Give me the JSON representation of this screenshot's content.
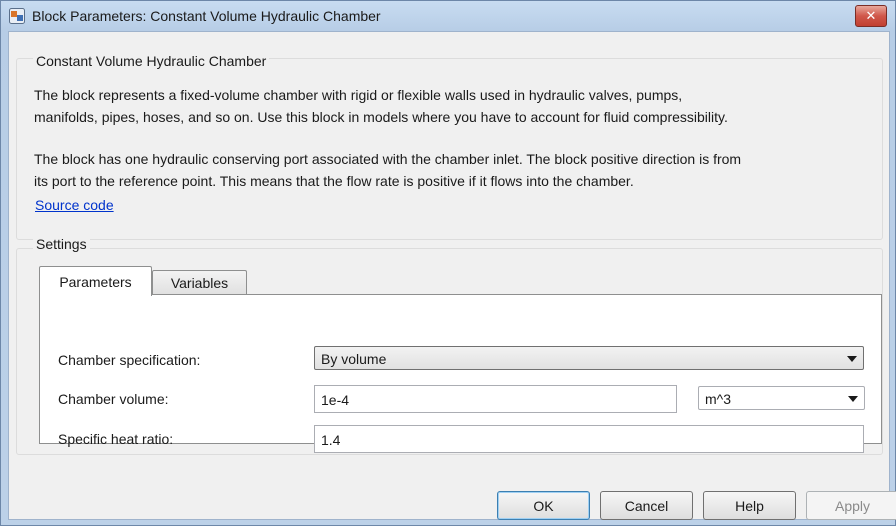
{
  "window": {
    "title": "Block Parameters: Constant Volume Hydraulic Chamber",
    "close_glyph": "✕"
  },
  "description": {
    "group_title": "Constant Volume Hydraulic Chamber",
    "paragraph1_line1": "The block represents a fixed-volume chamber with rigid or flexible walls used in hydraulic valves, pumps,",
    "paragraph1_line2": "manifolds, pipes, hoses, and so on. Use this block in models where you have to account for fluid compressibility.",
    "paragraph2_line1": "The block has one hydraulic conserving port associated with the chamber inlet. The block positive direction is from",
    "paragraph2_line2": "its port to the reference point. This means that the flow rate is positive if it flows into the chamber.",
    "link": "Source code"
  },
  "settings": {
    "group_title": "Settings",
    "tabs": [
      {
        "label": "Parameters",
        "active": true
      },
      {
        "label": "Variables",
        "active": false
      }
    ],
    "rows": {
      "chamber_specification": {
        "label": "Chamber specification:",
        "value": "By volume"
      },
      "chamber_volume": {
        "label": "Chamber volume:",
        "value": "1e-4",
        "unit": "m^3"
      },
      "specific_heat_ratio": {
        "label": "Specific heat ratio:",
        "value": "1.4"
      }
    }
  },
  "buttons": {
    "ok": "OK",
    "cancel": "Cancel",
    "help": "Help",
    "apply": "Apply"
  }
}
